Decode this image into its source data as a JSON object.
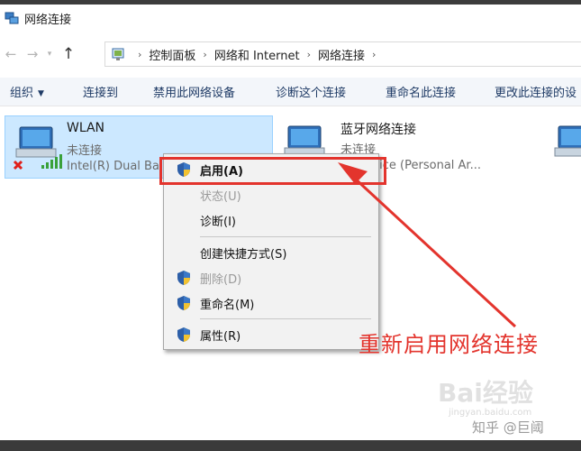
{
  "window": {
    "title": "网络连接"
  },
  "address": {
    "crumbs": [
      "控制面板",
      "网络和 Internet",
      "网络连接"
    ]
  },
  "toolbar": {
    "organize": "组织",
    "items": [
      "连接到",
      "禁用此网络设备",
      "诊断这个连接",
      "重命名此连接",
      "更改此连接的设"
    ]
  },
  "connections": [
    {
      "name": "WLAN",
      "status": "未连接",
      "device": "Intel(R) Dual Ba",
      "icon": "wifi-adapter-disconnected-icon"
    },
    {
      "name": "蓝牙网络连接",
      "status": "未连接",
      "device": "th Device (Personal Ar...",
      "icon": "bluetooth-adapter-icon"
    },
    {
      "name": "",
      "status": "",
      "device": "",
      "icon": "network-adapter-icon"
    }
  ],
  "context_menu": {
    "items": [
      {
        "label": "启用(A)",
        "shield": true,
        "disabled": false,
        "default": true
      },
      {
        "label": "状态(U)",
        "shield": false,
        "disabled": true
      },
      {
        "label": "诊断(I)",
        "shield": false,
        "disabled": false
      },
      {
        "label": "创建快捷方式(S)",
        "shield": false,
        "disabled": false
      },
      {
        "label": "删除(D)",
        "shield": true,
        "disabled": true
      },
      {
        "label": "重命名(M)",
        "shield": true,
        "disabled": false
      },
      {
        "label": "属性(R)",
        "shield": true,
        "disabled": false
      }
    ]
  },
  "annotation": {
    "text": "重新启用网络连接",
    "color": "#e3342d"
  },
  "watermarks": {
    "baidu": "Bai经验",
    "baidu_sub": "jingyan.baidu.com",
    "zhihu": "知乎 @巨阈"
  },
  "colors": {
    "accent": "#1f3b66",
    "selection": "#cce8ff",
    "annotation_red": "#e3342d"
  }
}
